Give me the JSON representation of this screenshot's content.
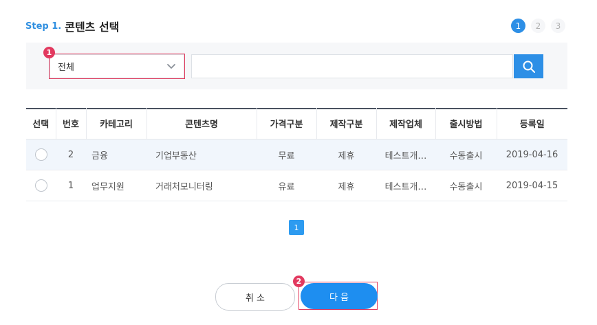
{
  "header": {
    "step_label": "Step 1.",
    "title": "콘텐츠 선택"
  },
  "stepper": [
    "1",
    "2",
    "3"
  ],
  "search": {
    "category_value": "전체",
    "keyword_value": "",
    "marker_1": "1"
  },
  "table": {
    "columns": [
      "선택",
      "번호",
      "카테고리",
      "콘텐츠명",
      "가격구분",
      "제작구분",
      "제작업체",
      "출시방법",
      "등록일"
    ],
    "rows": [
      {
        "no": "2",
        "category": "금융",
        "name": "기업부동산",
        "price": "무료",
        "production": "제휴",
        "maker": "테스트개…",
        "release": "수동출시",
        "date": "2019-04-16"
      },
      {
        "no": "1",
        "category": "업무지원",
        "name": "거래처모니터링",
        "price": "유료",
        "production": "제휴",
        "maker": "테스트개…",
        "release": "수동출시",
        "date": "2019-04-15"
      }
    ]
  },
  "pagination": {
    "current": "1"
  },
  "footer": {
    "cancel_label": "취 소",
    "next_label": "다 음",
    "marker_2": "2"
  },
  "colors": {
    "accent": "#2d8fe6",
    "marker": "#e2395f"
  }
}
